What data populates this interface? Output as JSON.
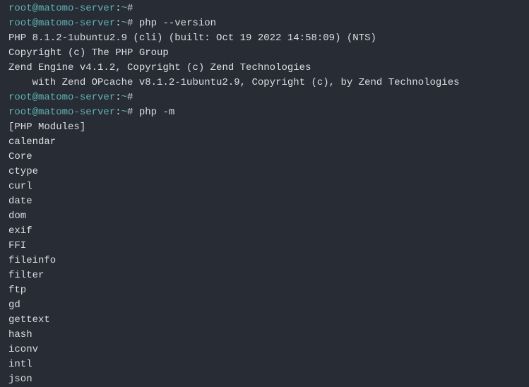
{
  "prompt": {
    "user": "root@matomo-server",
    "colon": ":",
    "tilde": "~",
    "hash": "#"
  },
  "commands": {
    "cmd1": "",
    "cmd2": " php --version",
    "cmd3": "",
    "cmd4": " php -m"
  },
  "versionOutput": {
    "line1": "PHP 8.1.2-1ubuntu2.9 (cli) (built: Oct 19 2022 14:58:09) (NTS)",
    "line2": "Copyright (c) The PHP Group",
    "line3": "Zend Engine v4.1.2, Copyright (c) Zend Technologies",
    "line4": "    with Zend OPcache v8.1.2-1ubuntu2.9, Copyright (c), by Zend Technologies"
  },
  "modulesHeader": "[PHP Modules]",
  "modules": [
    "calendar",
    "Core",
    "ctype",
    "curl",
    "date",
    "dom",
    "exif",
    "FFI",
    "fileinfo",
    "filter",
    "ftp",
    "gd",
    "gettext",
    "hash",
    "iconv",
    "intl",
    "json"
  ]
}
